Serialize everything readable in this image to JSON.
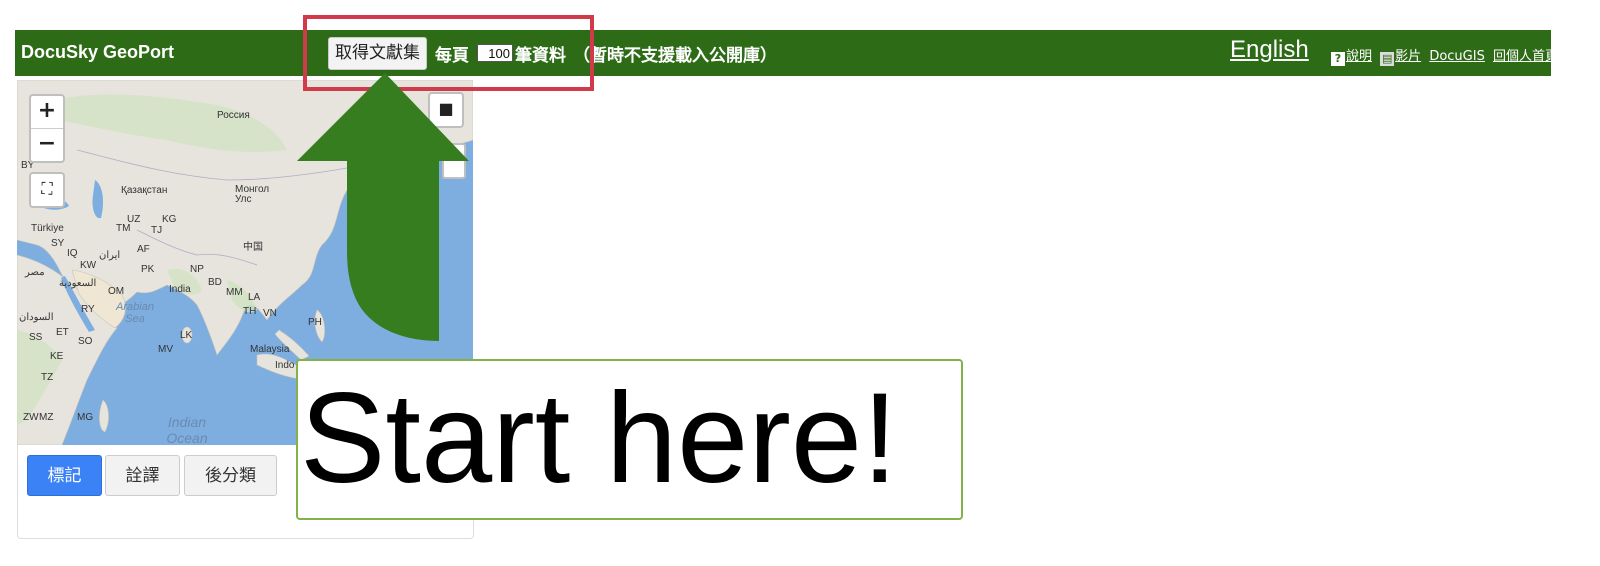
{
  "header": {
    "brand": "DocuSky GeoPort",
    "get_collection_button": "取得文獻集",
    "per_page_label": "每頁",
    "count_value": "100",
    "records_label": "筆資料",
    "note": "（暫時不支援載入公開庫）",
    "language_link": "English",
    "help_icon": "?",
    "help_link": "說明",
    "video_icon": "▤",
    "video_link": "影片",
    "docugis_link": "DocuGIS",
    "home_link": "回個人首頁"
  },
  "map": {
    "zoom_in": "+",
    "zoom_out": "−",
    "fullscreen": "⛶",
    "stop": "■",
    "labels": {
      "russia": "Россия",
      "kazakhstan": "Қазақстан",
      "mongolia": "Монгол Улс",
      "turkiye": "Türkiye",
      "china": "中国",
      "india": "India",
      "arabian_sea": "Arabian Sea",
      "indian_ocean": "Indian Ocean",
      "malaysia": "Malaysia",
      "egypt": "مصر",
      "saudi": "السعودية",
      "iran": "ایران",
      "sudan": "السودان",
      "uz": "UZ",
      "kg": "KG",
      "tm": "TM",
      "tj": "TJ",
      "af": "AF",
      "pk": "PK",
      "np": "NP",
      "bd": "BD",
      "mm": "MM",
      "la": "LA",
      "th": "TH",
      "vn": "VN",
      "ph": "PH",
      "lk": "LK",
      "mv": "MV",
      "om": "OM",
      "ry": "RY",
      "et": "ET",
      "so": "SO",
      "ke": "KE",
      "tz": "TZ",
      "mg": "MG",
      "zw": "ZW",
      "mz": "MZ",
      "sy": "SY",
      "iq": "IQ",
      "kw": "KW",
      "ss": "SS",
      "by": "BY",
      "indo": "Indo"
    }
  },
  "tabs": [
    {
      "label": "標記",
      "active": true
    },
    {
      "label": "詮譯",
      "active": false
    },
    {
      "label": "後分類",
      "active": false
    }
  ],
  "callout": {
    "text": "Start here!"
  },
  "colors": {
    "topbar": "#2e6b17",
    "highlight": "#d03a4a",
    "arrow": "#367d20",
    "tab_active": "#3b82f6",
    "callout_border": "#82b24a"
  }
}
